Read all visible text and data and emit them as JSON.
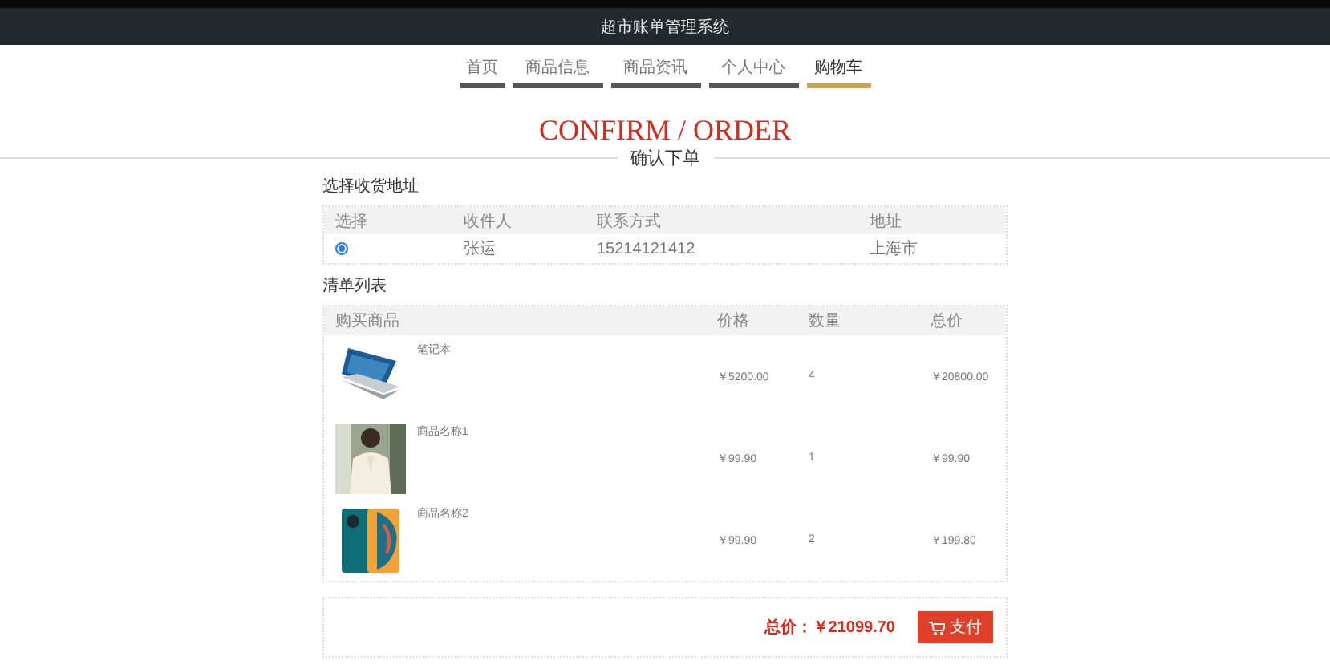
{
  "header": {
    "title": "超市账单管理系统"
  },
  "nav": [
    {
      "label": "首页",
      "selected": false
    },
    {
      "label": "商品信息",
      "selected": false
    },
    {
      "label": "商品资讯",
      "selected": false
    },
    {
      "label": "个人中心",
      "selected": false
    },
    {
      "label": "购物车",
      "selected": true
    }
  ],
  "page_title": {
    "english": "CONFIRM / ORDER",
    "chinese": "确认下单"
  },
  "address_section": {
    "title": "选择收货地址",
    "columns": [
      "选择",
      "收件人",
      "联系方式",
      "地址"
    ],
    "rows": [
      {
        "selected": true,
        "recipient": "张运",
        "phone": "15214121412",
        "address": "上海市"
      }
    ]
  },
  "cart_section": {
    "title": "清单列表",
    "columns": [
      "购买商品",
      "价格",
      "数量",
      "总价"
    ],
    "rows": [
      {
        "name": "笔记本",
        "kind": "picture",
        "price": "￥5200.00",
        "quantity": "4",
        "total": "￥20800.00"
      },
      {
        "name": "商品名称1",
        "kind": "picture",
        "price": "￥99.90",
        "quantity": "1",
        "total": "￥99.90"
      },
      {
        "name": "商品名称2",
        "kind": "picture",
        "price": "￥99.90",
        "quantity": "2",
        "total": "￥199.80"
      }
    ]
  },
  "summary": {
    "label": "总价：",
    "amount": "￥21099.70",
    "button": "支付"
  }
}
